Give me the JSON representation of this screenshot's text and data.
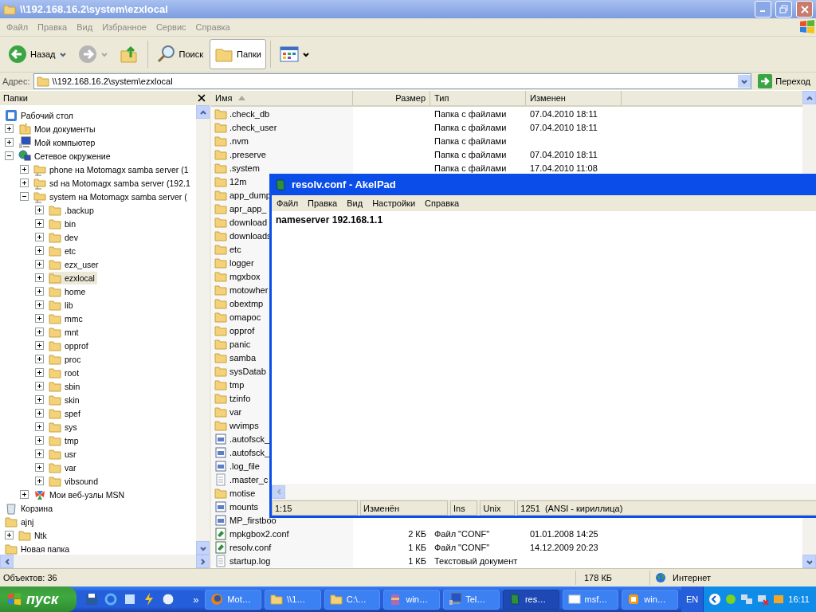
{
  "window": {
    "title": "\\\\192.168.16.2\\system\\ezxlocal"
  },
  "menu": [
    "Файл",
    "Правка",
    "Вид",
    "Избранное",
    "Сервис",
    "Справка"
  ],
  "toolbar": {
    "back": "Назад",
    "forward": {
      "disabled": true
    },
    "search": "Поиск",
    "folders": {
      "label": "Папки",
      "selected": true
    }
  },
  "address": {
    "label": "Адрес:",
    "value": "\\\\192.168.16.2\\system\\ezxlocal",
    "go": "Переход"
  },
  "folders_pane": {
    "title": "Папки",
    "tree": [
      {
        "kind": "desktop",
        "label": "Рабочий стол",
        "selected": false,
        "children": [
          {
            "kind": "documents",
            "label": "Мои документы",
            "expanded": false,
            "selected": false
          },
          {
            "kind": "computer",
            "label": "Мой компьютер",
            "expanded": false,
            "selected": false
          },
          {
            "kind": "network",
            "label": "Сетевое окружение",
            "expanded": true,
            "selected": false,
            "children": [
              {
                "kind": "share",
                "label": "phone на Motomagx samba server (1",
                "expanded": false,
                "selected": false
              },
              {
                "kind": "share",
                "label": "sd на Motomagx samba server (192.1",
                "expanded": false,
                "selected": false
              },
              {
                "kind": "share",
                "label": "system на Motomagx samba server (",
                "expanded": true,
                "selected": false,
                "children": [
                  {
                    "kind": "folder",
                    "label": ".backup",
                    "expanded": false,
                    "selected": false
                  },
                  {
                    "kind": "folder",
                    "label": "bin",
                    "expanded": false,
                    "selected": false
                  },
                  {
                    "kind": "folder",
                    "label": "dev",
                    "expanded": false,
                    "selected": false
                  },
                  {
                    "kind": "folder",
                    "label": "etc",
                    "expanded": false,
                    "selected": false
                  },
                  {
                    "kind": "folder",
                    "label": "ezx_user",
                    "expanded": false,
                    "selected": false
                  },
                  {
                    "kind": "folder",
                    "label": "ezxlocal",
                    "expanded": false,
                    "selected": true
                  },
                  {
                    "kind": "folder",
                    "label": "home",
                    "expanded": false,
                    "selected": false
                  },
                  {
                    "kind": "folder",
                    "label": "lib",
                    "expanded": false,
                    "selected": false
                  },
                  {
                    "kind": "folder",
                    "label": "mmc",
                    "expanded": false,
                    "selected": false
                  },
                  {
                    "kind": "folder",
                    "label": "mnt",
                    "expanded": false,
                    "selected": false
                  },
                  {
                    "kind": "folder",
                    "label": "opprof",
                    "expanded": false,
                    "selected": false
                  },
                  {
                    "kind": "folder",
                    "label": "proc",
                    "expanded": false,
                    "selected": false
                  },
                  {
                    "kind": "folder",
                    "label": "root",
                    "expanded": false,
                    "selected": false
                  },
                  {
                    "kind": "folder",
                    "label": "sbin",
                    "expanded": false,
                    "selected": false
                  },
                  {
                    "kind": "folder",
                    "label": "skin",
                    "expanded": false,
                    "selected": false
                  },
                  {
                    "kind": "folder",
                    "label": "spef",
                    "expanded": false,
                    "selected": false
                  },
                  {
                    "kind": "folder",
                    "label": "sys",
                    "expanded": false,
                    "selected": false
                  },
                  {
                    "kind": "folder",
                    "label": "tmp",
                    "expanded": false,
                    "selected": false
                  },
                  {
                    "kind": "folder",
                    "label": "usr",
                    "expanded": false,
                    "selected": false
                  },
                  {
                    "kind": "folder",
                    "label": "var",
                    "expanded": false,
                    "selected": false
                  },
                  {
                    "kind": "folder",
                    "label": "vibsound",
                    "expanded": false,
                    "selected": false
                  }
                ]
              },
              {
                "kind": "msn",
                "label": "Мои веб-узлы MSN",
                "expanded": false,
                "selected": false
              }
            ]
          },
          {
            "kind": "recycle",
            "label": "Корзина",
            "selected": false
          },
          {
            "kind": "folder",
            "label": "ajnj",
            "selected": false
          },
          {
            "kind": "folder",
            "label": "Ntk",
            "expanded": false,
            "selected": false
          },
          {
            "kind": "folder",
            "label": "Новая папка",
            "selected": false
          }
        ]
      }
    ]
  },
  "file_list": {
    "columns": [
      {
        "label": "Имя",
        "sorted": true
      },
      {
        "label": "Размер",
        "sorted": false
      },
      {
        "label": "Тип",
        "sorted": false
      },
      {
        "label": "Изменен",
        "sorted": false
      }
    ],
    "rows": [
      {
        "kind": "folder",
        "name": ".check_db",
        "type": "Папка с файлами",
        "modified": "07.04.2010 18:11"
      },
      {
        "kind": "folder",
        "name": ".check_user",
        "type": "Папка с файлами",
        "modified": "07.04.2010 18:11"
      },
      {
        "kind": "folder",
        "name": ".nvm",
        "type": "Папка с файлами"
      },
      {
        "kind": "folder",
        "name": ".preserve",
        "type": "Папка с файлами",
        "modified": "07.04.2010 18:11"
      },
      {
        "kind": "folder",
        "name": ".system",
        "type": "Папка с файлами",
        "modified": "17.04.2010 11:08"
      },
      {
        "kind": "folder",
        "name": "12m"
      },
      {
        "kind": "folder",
        "name": "app_dump"
      },
      {
        "kind": "folder",
        "name": "apr_app_"
      },
      {
        "kind": "folder",
        "name": "download"
      },
      {
        "kind": "folder",
        "name": "downloads"
      },
      {
        "kind": "folder",
        "name": "etc"
      },
      {
        "kind": "folder",
        "name": "logger"
      },
      {
        "kind": "folder",
        "name": "mgxbox"
      },
      {
        "kind": "folder",
        "name": "motowher"
      },
      {
        "kind": "folder",
        "name": "obextmp"
      },
      {
        "kind": "folder",
        "name": "omapoc"
      },
      {
        "kind": "folder",
        "name": "opprof"
      },
      {
        "kind": "folder",
        "name": "panic"
      },
      {
        "kind": "folder",
        "name": "samba"
      },
      {
        "kind": "folder",
        "name": "sysDatab"
      },
      {
        "kind": "folder",
        "name": "tmp"
      },
      {
        "kind": "folder",
        "name": "tzinfo"
      },
      {
        "kind": "folder",
        "name": "var"
      },
      {
        "kind": "folder",
        "name": "wvimps"
      },
      {
        "kind": "system",
        "name": ".autofsck_"
      },
      {
        "kind": "system",
        "name": ".autofsck_"
      },
      {
        "kind": "system",
        "name": ".log_file"
      },
      {
        "kind": "text",
        "name": ".master_c"
      },
      {
        "kind": "folder",
        "name": "motise"
      },
      {
        "kind": "system",
        "name": "mounts"
      },
      {
        "kind": "system",
        "name": "MP_firstboo"
      },
      {
        "kind": "conf",
        "name": "mpkgbox2.conf",
        "size": "2 КБ",
        "type": "Файл \"CONF\"",
        "modified": "01.01.2008 14:25"
      },
      {
        "kind": "conf",
        "name": "resolv.conf",
        "size": "1 КБ",
        "type": "Файл \"CONF\"",
        "modified": "14.12.2009 20:23"
      },
      {
        "kind": "text",
        "name": "startup.log",
        "size": "1 КБ",
        "type": "Текстовый документ"
      }
    ]
  },
  "editor": {
    "title": "resolv.conf - AkelPad",
    "menu": [
      "Файл",
      "Правка",
      "Вид",
      "Настройки",
      "Справка"
    ],
    "text": "nameserver 192.168.1.1",
    "status": [
      "1:15",
      "Изменён",
      "Ins",
      "Unix",
      "1251  (ANSI - кириллица)"
    ]
  },
  "status_bar": {
    "objects": "Объектов: 36",
    "size": "178 КБ",
    "zone": "Интернет"
  },
  "taskbar": {
    "start": "пуск",
    "more": "»",
    "buttons": [
      {
        "kind": "browser",
        "label": "Mot…",
        "selected": false
      },
      {
        "kind": "folder",
        "label": "\\\\1…",
        "selected": false
      },
      {
        "kind": "folder",
        "label": "C:\\…",
        "selected": false
      },
      {
        "kind": "archive",
        "label": "win…",
        "selected": false
      },
      {
        "kind": "computer",
        "label": "Tel…",
        "selected": false
      },
      {
        "kind": "notepad",
        "label": "res…",
        "selected": true
      },
      {
        "kind": "window",
        "label": "msf…",
        "selected": false
      },
      {
        "kind": "app",
        "label": "win…",
        "selected": false
      }
    ],
    "language": "EN",
    "clock": "16:11"
  }
}
